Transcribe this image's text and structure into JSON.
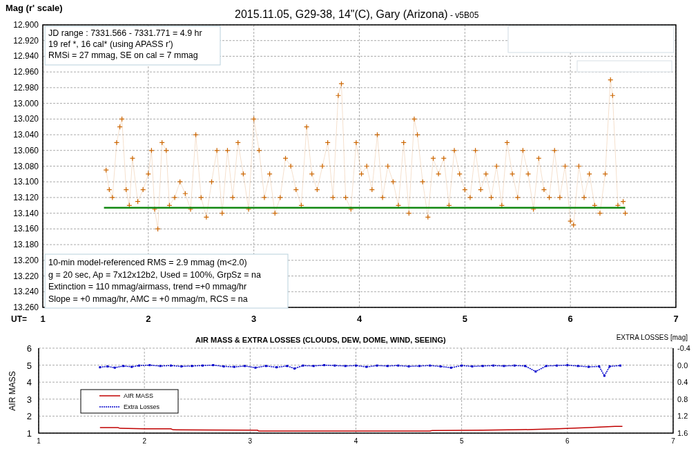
{
  "light_curve": {
    "y_axis_title": "Mag (r' scale)",
    "title": "2015.11.05, G29-38, 14\"(C), Gary (Arizona)",
    "version": "- v5B05",
    "x_axis_prefix": "UT=",
    "info_box_top": [
      "JD range : 7331.566 - 7331.771 = 4.9 hr",
      "19 ref *, 16 cal* (using APASS r')",
      "RMSi = 27 mmag, SE on cal = 7 mmag"
    ],
    "info_box_bottom": [
      "10-min model-referenced RMS = 2.9 mmag (m<2.0)",
      "g = 20 sec, Ap = 7x12x12b2, Used = 100%, GrpSz = na",
      "Extinction = 110 mmag/airmass, trend =+0 mmag/hr",
      "Slope = +0 mmag/hr, AMC = +0 mmag/m, RCS = na"
    ],
    "chart_data": {
      "type": "line",
      "grid": true,
      "xlim": [
        1,
        7
      ],
      "ylim": [
        13.26,
        12.9
      ],
      "xticks": [
        1,
        2,
        3,
        4,
        5,
        6,
        7
      ],
      "yticks": [
        {
          "value": 12.9,
          "label": "12.900"
        },
        {
          "value": 12.92,
          "label": "12.920"
        },
        {
          "value": 12.94,
          "label": "12.940"
        },
        {
          "value": 12.96,
          "label": "12.960"
        },
        {
          "value": 12.98,
          "label": "12.980"
        },
        {
          "value": 13.0,
          "label": "13.000"
        },
        {
          "value": 13.02,
          "label": "13.020"
        },
        {
          "value": 13.04,
          "label": "13.040"
        },
        {
          "value": 13.06,
          "label": "13.060"
        },
        {
          "value": 13.08,
          "label": "13.080"
        },
        {
          "value": 13.1,
          "label": "13.100"
        },
        {
          "value": 13.12,
          "label": "13.120"
        },
        {
          "value": 13.14,
          "label": "13.140"
        },
        {
          "value": 13.16,
          "label": "13.160"
        },
        {
          "value": 13.18,
          "label": "13.180"
        },
        {
          "value": 13.2,
          "label": "13.200"
        },
        {
          "value": 13.22,
          "label": "13.220"
        },
        {
          "value": 13.24,
          "label": "13.240"
        },
        {
          "value": 13.26,
          "label": "13.260"
        }
      ],
      "series": [
        {
          "color": "#cc6600",
          "marker": "plus",
          "x": [
            1.6,
            1.63,
            1.66,
            1.7,
            1.73,
            1.75,
            1.79,
            1.82,
            1.85,
            1.9,
            1.95,
            2.0,
            2.03,
            2.06,
            2.09,
            2.13,
            2.17,
            2.2,
            2.25,
            2.3,
            2.35,
            2.4,
            2.45,
            2.5,
            2.55,
            2.6,
            2.65,
            2.7,
            2.75,
            2.8,
            2.85,
            2.9,
            2.95,
            3.0,
            3.05,
            3.1,
            3.15,
            3.2,
            3.25,
            3.3,
            3.35,
            3.4,
            3.45,
            3.5,
            3.55,
            3.6,
            3.65,
            3.7,
            3.75,
            3.8,
            3.83,
            3.87,
            3.92,
            3.97,
            4.02,
            4.07,
            4.12,
            4.17,
            4.22,
            4.27,
            4.32,
            4.37,
            4.42,
            4.47,
            4.52,
            4.55,
            4.6,
            4.65,
            4.7,
            4.75,
            4.8,
            4.85,
            4.9,
            4.95,
            5.0,
            5.05,
            5.1,
            5.15,
            5.2,
            5.25,
            5.3,
            5.35,
            5.4,
            5.45,
            5.5,
            5.55,
            5.6,
            5.65,
            5.7,
            5.75,
            5.8,
            5.85,
            5.9,
            5.95,
            6.0,
            6.03,
            6.08,
            6.13,
            6.18,
            6.23,
            6.28,
            6.33,
            6.38,
            6.4,
            6.45,
            6.5,
            6.52
          ],
          "values": [
            13.085,
            13.11,
            13.12,
            13.05,
            13.03,
            13.02,
            13.11,
            13.13,
            13.07,
            13.125,
            13.11,
            13.09,
            13.06,
            13.135,
            13.16,
            13.05,
            13.06,
            13.13,
            13.12,
            13.1,
            13.115,
            13.135,
            13.04,
            13.12,
            13.145,
            13.1,
            13.06,
            13.14,
            13.06,
            13.12,
            13.05,
            13.09,
            13.135,
            13.02,
            13.06,
            13.12,
            13.09,
            13.14,
            13.12,
            13.07,
            13.08,
            13.11,
            13.13,
            13.03,
            13.09,
            13.11,
            13.08,
            13.05,
            13.12,
            12.99,
            12.975,
            13.12,
            13.135,
            13.05,
            13.09,
            13.08,
            13.11,
            13.04,
            13.12,
            13.08,
            13.1,
            13.13,
            13.05,
            13.14,
            13.02,
            13.04,
            13.1,
            13.145,
            13.07,
            13.09,
            13.07,
            13.13,
            13.06,
            13.09,
            13.11,
            13.12,
            13.06,
            13.11,
            13.09,
            13.12,
            13.08,
            13.13,
            13.05,
            13.09,
            13.12,
            13.06,
            13.09,
            13.135,
            13.07,
            13.11,
            13.12,
            13.06,
            13.12,
            13.08,
            13.15,
            13.155,
            13.08,
            13.12,
            13.09,
            13.13,
            13.14,
            13.09,
            12.97,
            12.99,
            13.13,
            13.125,
            13.14
          ]
        },
        {
          "color": "#118811",
          "x": [
            1.58,
            6.52
          ],
          "values": [
            13.133,
            13.133
          ]
        }
      ]
    }
  },
  "air_mass_chart": {
    "title": "AIR MASS & EXTRA LOSSES (CLOUDS, DEW, DOME, WIND, SEEING)",
    "ylabel": "AIR MASS",
    "y2label": "EXTRA LOSSES [mag]",
    "chart_data": {
      "type": "line",
      "grid": true,
      "legend": true,
      "xlim": [
        1,
        7
      ],
      "ylim": [
        1,
        6
      ],
      "y2lim": [
        1.6,
        -0.4
      ],
      "xticks": [
        1,
        2,
        3,
        4,
        5,
        6,
        7
      ],
      "yticks": [
        1,
        2,
        3,
        4,
        5,
        6
      ],
      "y2ticks": [
        {
          "value": -0.4,
          "label": "-0.4"
        },
        {
          "value": 0,
          "label": "0.0"
        },
        {
          "value": 0.4,
          "label": "0.4"
        },
        {
          "value": 0.8,
          "label": "0.8"
        },
        {
          "value": 1.2,
          "label": "1.2"
        },
        {
          "value": 1.6,
          "label": "1.6"
        }
      ],
      "series": [
        {
          "name": "AIR MASS",
          "color": "#c00000",
          "x": [
            1.58,
            1.75,
            1.77,
            2.0,
            2.25,
            2.27,
            2.6,
            3.07,
            3.08,
            4.7,
            4.72,
            5.2,
            5.55,
            5.9,
            6.2,
            6.45,
            6.52
          ],
          "values": [
            1.32,
            1.32,
            1.28,
            1.25,
            1.25,
            1.2,
            1.18,
            1.17,
            1.12,
            1.12,
            1.15,
            1.17,
            1.2,
            1.25,
            1.32,
            1.4,
            1.4
          ]
        },
        {
          "name": "Extra Losses",
          "color": "#0000cc",
          "axis": "y2",
          "marker": "square",
          "line_style": "dashed",
          "x": [
            1.58,
            1.65,
            1.72,
            1.8,
            1.88,
            1.95,
            2.05,
            2.15,
            2.25,
            2.35,
            2.45,
            2.55,
            2.65,
            2.75,
            2.85,
            2.95,
            3.05,
            3.15,
            3.25,
            3.35,
            3.42,
            3.5,
            3.6,
            3.7,
            3.8,
            3.9,
            4.0,
            4.1,
            4.2,
            4.3,
            4.4,
            4.5,
            4.6,
            4.7,
            4.8,
            4.9,
            5.0,
            5.1,
            5.2,
            5.3,
            5.4,
            5.5,
            5.6,
            5.7,
            5.8,
            5.9,
            6.0,
            6.1,
            6.2,
            6.3,
            6.35,
            6.4,
            6.5
          ],
          "values": [
            0.05,
            0.03,
            0.06,
            0.02,
            0.04,
            0.01,
            0.0,
            0.02,
            0.01,
            0.03,
            0.02,
            0.01,
            0.0,
            0.03,
            0.04,
            0.02,
            0.06,
            0.02,
            0.05,
            0.02,
            0.08,
            0.01,
            0.02,
            0.0,
            0.01,
            0.02,
            0.01,
            0.04,
            0.01,
            0.02,
            0.01,
            0.03,
            0.02,
            0.01,
            0.03,
            0.06,
            0.01,
            0.03,
            0.02,
            0.01,
            0.02,
            0.01,
            0.02,
            0.15,
            0.02,
            0.01,
            0.0,
            0.02,
            0.04,
            0.03,
            0.25,
            0.03,
            0.01
          ]
        }
      ]
    }
  }
}
